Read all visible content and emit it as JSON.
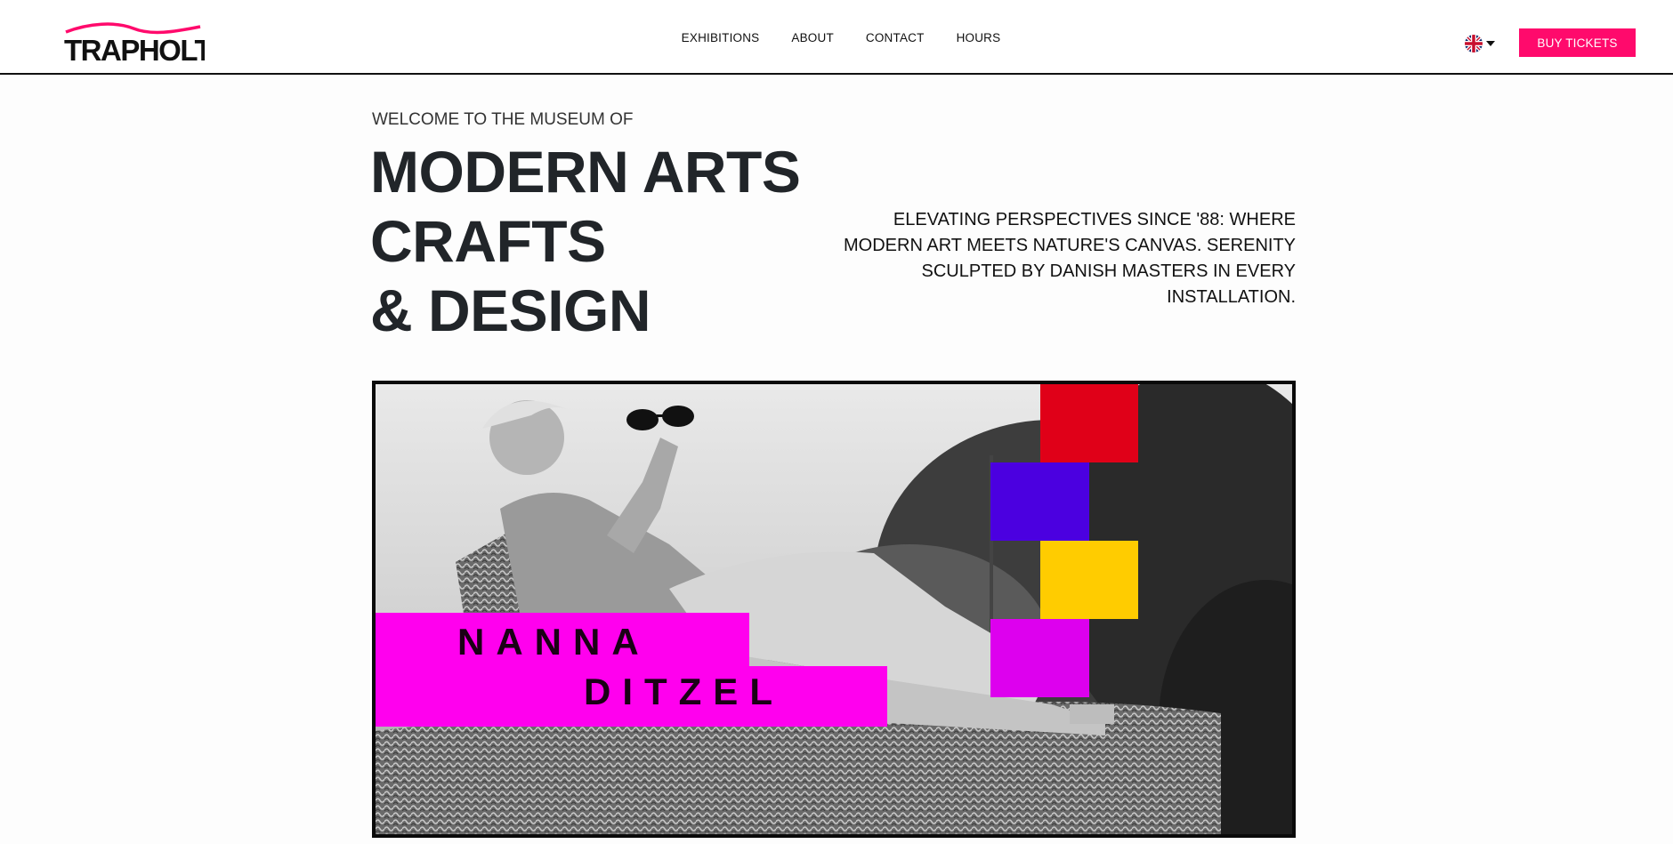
{
  "header": {
    "logo_text": "TRAPHOLT",
    "nav": [
      {
        "label": "EXHIBITIONS"
      },
      {
        "label": "ABOUT"
      },
      {
        "label": "CONTACT"
      },
      {
        "label": "HOURS"
      }
    ],
    "language_icon": "uk-flag-icon",
    "buy_label": "BUY TICKETS"
  },
  "hero": {
    "welcome": "WELCOME TO THE MUSEUM OF",
    "headline": [
      "MODERN ARTS",
      "CRAFTS",
      "& DESIGN"
    ],
    "tagline": "ELEVATING PERSPECTIVES SINCE '88: WHERE MODERN ART MEETS NATURE'S CANVAS. SERENITY SCULPTED BY DANISH MASTERS IN EVERY INSTALLATION."
  },
  "feature": {
    "name_first": "NANNA",
    "name_last": "DITZEL"
  },
  "colors": {
    "accent": "#ff0a6c",
    "magenta": "#ff00ee",
    "red": "#e00018",
    "blue": "#4b00e0",
    "yellow": "#ffcc00",
    "purple": "#dd00ee"
  }
}
